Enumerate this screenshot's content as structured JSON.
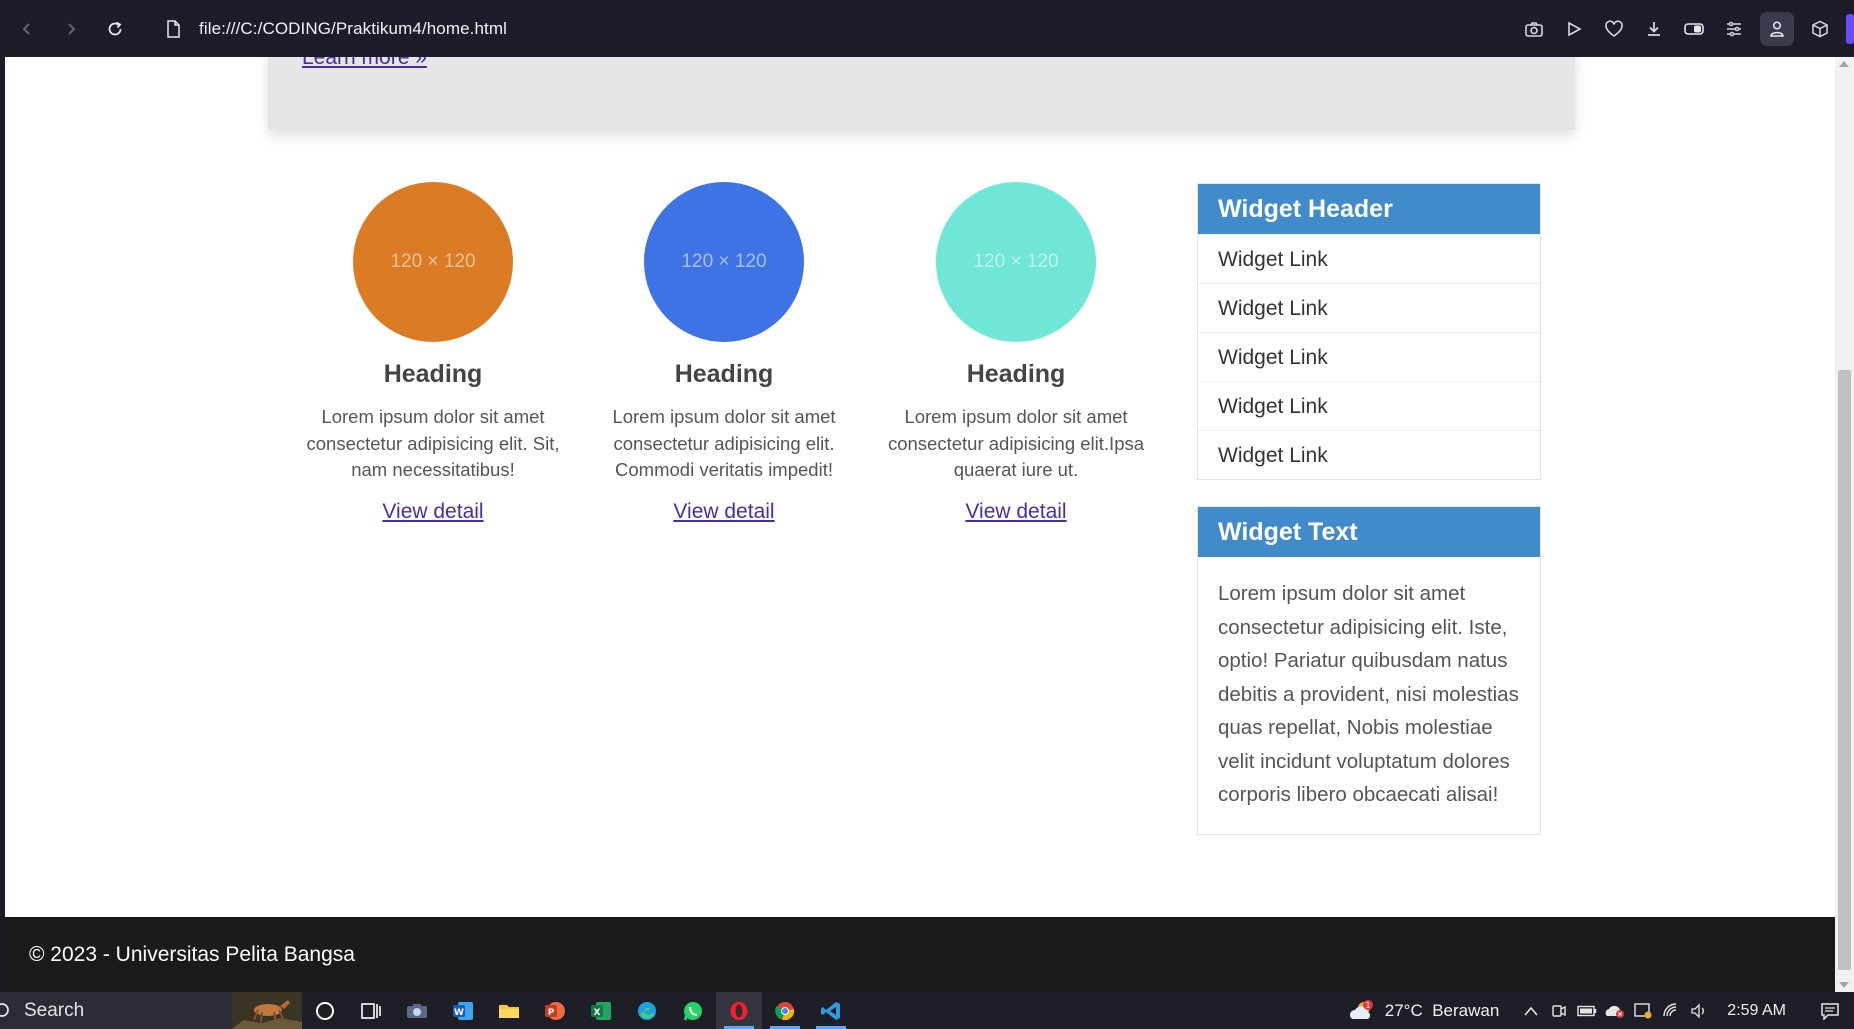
{
  "browser": {
    "url": "file:///C:/CODING/Praktikum4/home.html",
    "accent_color": "#6a4cff"
  },
  "hero": {
    "link_label": "Learn more »"
  },
  "features": [
    {
      "placeholder": "120 × 120",
      "color": "#db7b24",
      "heading": "Heading",
      "text": "Lorem ipsum dolor sit amet consectetur adipisicing elit. Sit, nam necessitatibus!",
      "link": "View detail"
    },
    {
      "placeholder": "120 × 120",
      "color": "#3e73e6",
      "heading": "Heading",
      "text": "Lorem ipsum dolor sit amet consectetur adipisicing elit. Commodi veritatis impedit!",
      "link": "View detail"
    },
    {
      "placeholder": "120 × 120",
      "color": "#70e6d6",
      "heading": "Heading",
      "text": "Lorem ipsum dolor sit amet consectetur adipisicing elit.Ipsa quaerat iure ut.",
      "link": "View detail"
    }
  ],
  "sidebar": {
    "links_widget": {
      "header": "Widget Header",
      "links": [
        "Widget Link",
        "Widget Link",
        "Widget Link",
        "Widget Link",
        "Widget Link"
      ]
    },
    "text_widget": {
      "header": "Widget Text",
      "body": "Lorem ipsum dolor sit amet consectetur adipisicing elit. Iste, optio! Pariatur quibusdam natus debitis a provident, nisi molestias quas repellat, Nobis molestiae velit incidunt voluptatum dolores corporis libero obcaecati alisai!"
    },
    "header_color": "#428bca"
  },
  "footer": {
    "text": "© 2023 - Universitas Pelita Bangsa"
  },
  "taskbar": {
    "search_placeholder": "Search",
    "weather": "27°C  Berawan",
    "weather_badge": "1",
    "time": "2:59 AM",
    "apps": [
      "cortana-icon",
      "task-view-icon",
      "camera-app-icon",
      "word-icon",
      "file-explorer-icon",
      "powerpoint-icon",
      "excel-icon",
      "edge-icon",
      "whatsapp-icon",
      "opera-icon",
      "chrome-icon",
      "vscode-icon"
    ]
  }
}
